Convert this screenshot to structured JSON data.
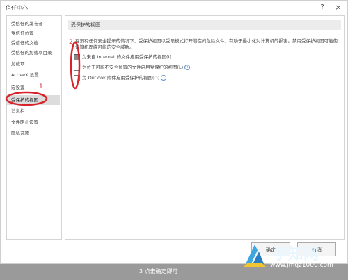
{
  "window": {
    "title": "信任中心",
    "help": "?",
    "close": "×"
  },
  "sidebar": {
    "items": [
      {
        "label": "受信任的发布者"
      },
      {
        "label": "受信任位置"
      },
      {
        "label": "受信任的文档"
      },
      {
        "label": "受信任的加载项目录"
      },
      {
        "label": "加载项"
      },
      {
        "label": "ActiveX 设置"
      },
      {
        "label": "宏设置"
      },
      {
        "label": "受保护的视图"
      },
      {
        "label": "消息栏"
      },
      {
        "label": "文件阻止设置"
      },
      {
        "label": "隐私选项"
      }
    ],
    "selected_index": 7
  },
  "main": {
    "section_title": "受保护的视图",
    "description": "在没有任何安全提示的情况下，受保护视图以受限模式打开潜在的危险文件，有助于最小化对计算机的损害。禁用受保护视图可能使计算机面临可能的安全威胁。",
    "options": [
      {
        "label": "为来自 Internet 的文件启用受保护的视图(I)",
        "checked": true,
        "info": false
      },
      {
        "label": "为位于可能不安全位置的文件启用受保护的视图(L)",
        "checked": false,
        "info": true
      },
      {
        "label": "为 Outlook 附件启用受保护的视图(O)",
        "checked": false,
        "info": true
      }
    ]
  },
  "buttons": {
    "ok": "确定",
    "cancel": "取消"
  },
  "annotations": {
    "one": "1",
    "two": "2",
    "color": "#d8232a"
  },
  "overlay": {
    "footer_text": "3 点击确定即可",
    "logo_name": "学知网",
    "logo_url": "www.jmqz1000.com"
  }
}
